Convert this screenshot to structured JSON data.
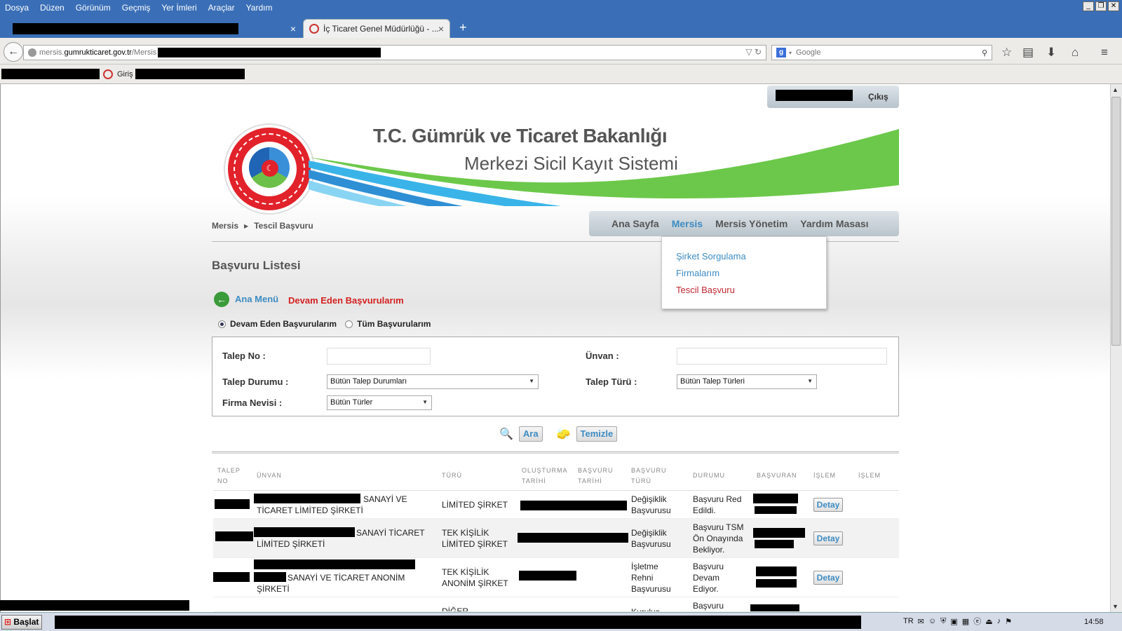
{
  "menubar": {
    "items": [
      "Dosya",
      "Düzen",
      "Görünüm",
      "Geçmiş",
      "Yer İmleri",
      "Araçlar",
      "Yardım"
    ]
  },
  "tabs": [
    {
      "label": ""
    },
    {
      "label": "İç Ticaret Genel Müdürlüğü - ..."
    }
  ],
  "tab_close": "×",
  "new_tab": "+",
  "address": {
    "prefix": "mersis.",
    "domain": "gumrukticaret.gov.tr",
    "path": "/Mersis"
  },
  "search": {
    "placeholder": "Google"
  },
  "bookmarks": {
    "giris": "Giriş"
  },
  "user": {
    "logout": "Çıkış"
  },
  "header": {
    "title": "T.C. Gümrük ve Ticaret Bakanlığı",
    "subtitle": "Merkezi Sicil Kayıt Sistemi"
  },
  "breadcrumb": [
    "Mersis",
    "Tescil Başvuru"
  ],
  "nav": [
    "Ana Sayfa",
    "Mersis",
    "Mersis Yönetim",
    "Yardım Masası"
  ],
  "dropdown": [
    "Şirket Sorgulama",
    "Firmalarım",
    "Tescil Başvuru"
  ],
  "page": {
    "title": "Başvuru Listesi",
    "back": "Ana Menü",
    "current": "Devam Eden Başvurularım"
  },
  "radios": [
    "Devam Eden Başvurularım",
    "Tüm Başvurularım"
  ],
  "filters": {
    "talep_no": "Talep No :",
    "unvan": "Ünvan :",
    "talep_durumu": "Talep Durumu :",
    "talep_durumu_value": "Bütün Talep Durumları",
    "talep_turu": "Talep Türü :",
    "talep_turu_value": "Bütün Talep Türleri",
    "firma_nevisi": "Firma Nevisi :",
    "firma_nevisi_value": "Bütün Türler"
  },
  "buttons": {
    "search": "Ara",
    "clear": "Temizle"
  },
  "table": {
    "headers": {
      "talep_no": [
        "TALEP",
        "NO"
      ],
      "unvan": "ÜNVAN",
      "turu": "TÜRÜ",
      "olusturma": [
        "OLUŞTURMA",
        "TARİHİ"
      ],
      "basvuru_tarihi": [
        "BAŞVURU",
        "TARİHİ"
      ],
      "basvuru_turu": [
        "BAŞVURU",
        "TÜRÜ"
      ],
      "durumu": "DURUMU",
      "basvuran": "BAŞVURAN",
      "islem1": "İŞLEM",
      "islem2": "İŞLEM"
    },
    "rows": [
      {
        "unvan1": "SANAYİ VE",
        "unvan2": "TİCARET LİMİTED ŞİRKETİ",
        "turu": "LİMİTED ŞİRKET",
        "bturu1": "Değişiklik",
        "bturu2": "Başvurusu",
        "durum1": "Başvuru Red",
        "durum2": "Edildi.",
        "durum3": "",
        "action": "Detay"
      },
      {
        "unvan1": "SANAYİ TİCARET",
        "unvan2": "LİMİTED ŞİRKETİ",
        "turu1": "TEK KİŞİLİK",
        "turu2": "LİMİTED ŞİRKET",
        "bturu1": "Değişiklik",
        "bturu2": "Başvurusu",
        "durum1": "Başvuru TSM",
        "durum2": "Ön Onayında",
        "durum3": "Bekliyor.",
        "action": "Detay"
      },
      {
        "unvan1": "SANAYİ VE TİCARET ANONİM",
        "unvan2": "ŞİRKETİ",
        "turu1": "TEK KİŞİLİK",
        "turu2": "ANONİM ŞİRKET",
        "bturu1": "İşletme",
        "bturu2": "Rehni",
        "bturu3": "Başvurusu",
        "durum1": "Başvuru",
        "durum2": "Devam",
        "durum3": "Ediyor.",
        "action": "Detay"
      },
      {
        "turu": "DİĞER",
        "bturu": "Kuruluş",
        "durum": "Başvuru"
      }
    ]
  },
  "taskbar": {
    "start": "Başlat",
    "lang": "TR",
    "clock": "14:58"
  }
}
